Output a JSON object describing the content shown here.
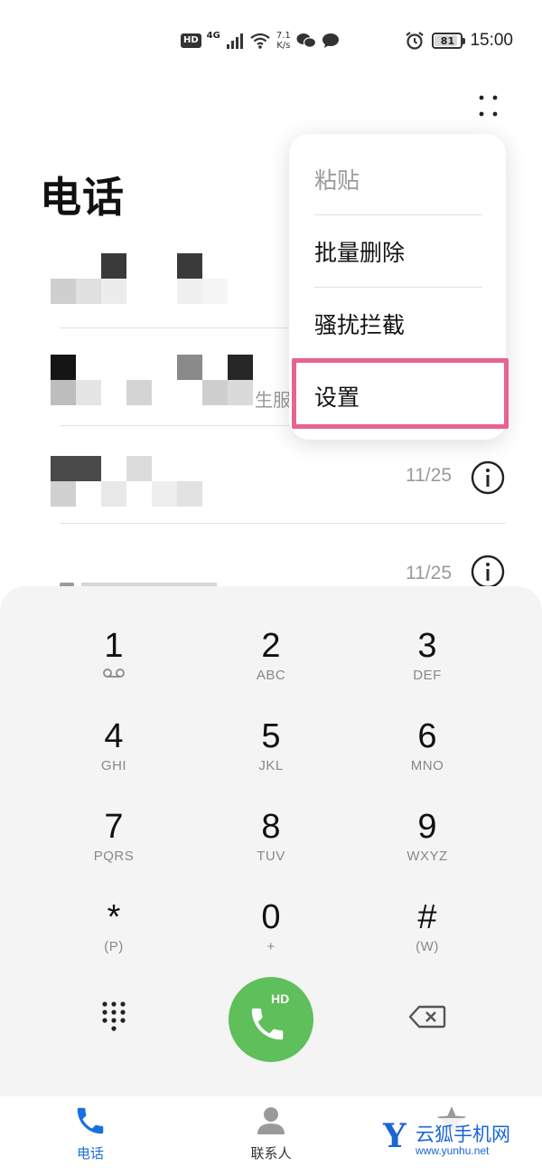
{
  "status_bar": {
    "hd": "HD",
    "network": "4G",
    "speed_value": "7.1",
    "speed_unit": "K/s",
    "battery": "81",
    "time": "15:00"
  },
  "header": {
    "title": "电话",
    "more_icon": "more-vertical-dots-icon"
  },
  "popup_menu": {
    "items": [
      {
        "label": "粘贴",
        "enabled": false
      },
      {
        "label": "批量删除",
        "enabled": true
      },
      {
        "label": "骚扰拦截",
        "enabled": true
      },
      {
        "label": "设置",
        "enabled": true,
        "highlighted": true
      }
    ],
    "highlight_color": "#e8638e"
  },
  "call_log": [
    {
      "name": "",
      "note": "",
      "date": ""
    },
    {
      "name": "",
      "note": "生服",
      "date": ""
    },
    {
      "name": "",
      "note": "",
      "date": "11/25"
    },
    {
      "name": "",
      "note": "",
      "date": "11/25"
    }
  ],
  "dialpad": {
    "keys": [
      {
        "digit": "1",
        "letters": "",
        "icon": "voicemail-icon"
      },
      {
        "digit": "2",
        "letters": "ABC"
      },
      {
        "digit": "3",
        "letters": "DEF"
      },
      {
        "digit": "4",
        "letters": "GHI"
      },
      {
        "digit": "5",
        "letters": "JKL"
      },
      {
        "digit": "6",
        "letters": "MNO"
      },
      {
        "digit": "7",
        "letters": "PQRS"
      },
      {
        "digit": "8",
        "letters": "TUV"
      },
      {
        "digit": "9",
        "letters": "WXYZ"
      },
      {
        "digit": "*",
        "letters": "(P)"
      },
      {
        "digit": "0",
        "letters": "+"
      },
      {
        "digit": "#",
        "letters": "(W)"
      }
    ],
    "call_button_badge": "HD",
    "call_button_color": "#5fbf5b"
  },
  "bottom_nav": {
    "items": [
      {
        "label": "电话",
        "icon": "phone-icon",
        "active": true
      },
      {
        "label": "联系人",
        "icon": "contacts-icon",
        "active": false
      },
      {
        "label": "",
        "icon": "favorites-icon",
        "active": false
      }
    ],
    "active_color": "#1a6fe0"
  },
  "watermark": {
    "letter": "Y",
    "name": "云狐手机网",
    "url": "www.yunhu.net"
  }
}
